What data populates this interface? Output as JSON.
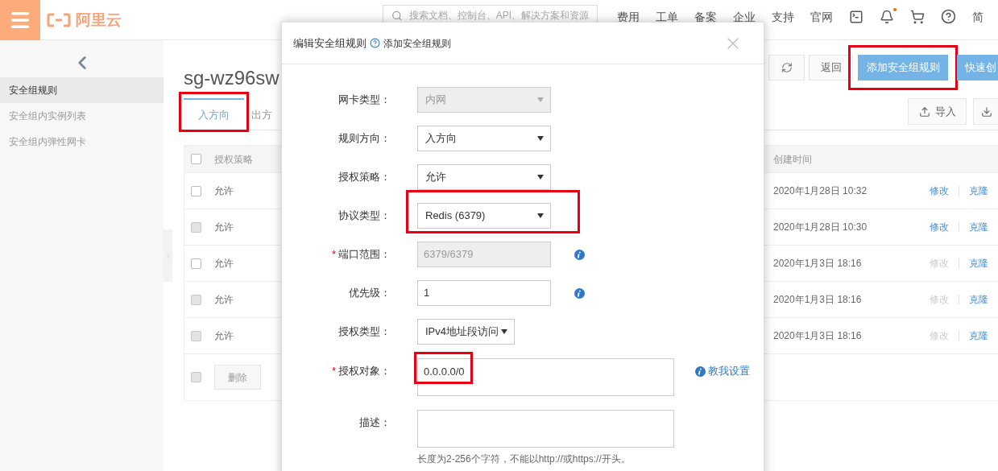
{
  "top_bar": {
    "logo": "阿里云",
    "search": {
      "placeholder": "搜索文档、控制台、API、解决方案和资源"
    },
    "nav": [
      "费用",
      "工单",
      "备案",
      "企业",
      "支持",
      "官网"
    ],
    "notification_dot": true,
    "language": "简"
  },
  "sidebar": {
    "items": [
      {
        "label": "安全组规则",
        "selected": true
      },
      {
        "label": "安全组内实例列表",
        "selected": false
      },
      {
        "label": "安全组内弹性网卡",
        "selected": false
      }
    ]
  },
  "page": {
    "title": "sg-wz96sw",
    "toolbar": [
      {
        "label": "返回",
        "kind": "default",
        "highlighted": false
      },
      {
        "label": "添加安全组规则",
        "kind": "primary",
        "highlighted": true
      },
      {
        "label": "快速创",
        "kind": "primary",
        "highlighted": false
      }
    ],
    "tabs": [
      {
        "label": "入方向",
        "selected": true,
        "highlighted": true
      },
      {
        "label": "出方",
        "selected": false,
        "highlighted": false
      }
    ],
    "import_button": "导入"
  },
  "table": {
    "columns": [
      "授权策略",
      "创建时间"
    ],
    "header_checked": false,
    "rows": [
      {
        "checked": false,
        "disabled": false,
        "policy": "允许",
        "created": "2020年1月28日 10:32",
        "actions": [
          {
            "label": "修改",
            "disabled": false
          },
          {
            "label": "克隆",
            "disabled": false
          }
        ]
      },
      {
        "checked": false,
        "disabled": true,
        "policy": "允许",
        "created": "2020年1月28日 10:30",
        "actions": [
          {
            "label": "修改",
            "disabled": false
          },
          {
            "label": "克隆",
            "disabled": false
          }
        ]
      },
      {
        "checked": false,
        "disabled": false,
        "policy": "允许",
        "created": "2020年1月3日 18:16",
        "actions": [
          {
            "label": "修改",
            "disabled": true
          },
          {
            "label": "克隆",
            "disabled": false
          }
        ]
      },
      {
        "checked": false,
        "disabled": true,
        "policy": "允许",
        "created": "2020年1月3日 18:16",
        "actions": [
          {
            "label": "修改",
            "disabled": true
          },
          {
            "label": "克隆",
            "disabled": false
          }
        ]
      },
      {
        "checked": false,
        "disabled": true,
        "policy": "允许",
        "created": "2020年1月3日 18:16",
        "actions": [
          {
            "label": "修改",
            "disabled": true
          },
          {
            "label": "克隆",
            "disabled": false
          }
        ]
      }
    ],
    "footer": {
      "checked": false,
      "delete_button": {
        "label": "删除",
        "disabled": true
      }
    }
  },
  "dialog": {
    "title": "编辑安全组规则",
    "help_link": "添加安全组规则",
    "fields": [
      {
        "label": "网卡类型：",
        "kind": "select",
        "value": "内网",
        "disabled": true,
        "info": false,
        "highlighted": false
      },
      {
        "label": "规则方向：",
        "kind": "select",
        "value": "入方向",
        "disabled": false,
        "info": false,
        "highlighted": false
      },
      {
        "label": "授权策略：",
        "kind": "select",
        "value": "允许",
        "disabled": false,
        "info": false,
        "highlighted": false
      },
      {
        "label": "协议类型：",
        "kind": "select",
        "value": "Redis (6379)",
        "disabled": false,
        "info": false,
        "highlighted": true
      },
      {
        "label": "端口范围：",
        "required_mark": "*",
        "kind": "input",
        "value": "6379/6379",
        "disabled": true,
        "info": true,
        "highlighted": false
      },
      {
        "label": "优先级：",
        "kind": "input",
        "value": "1",
        "disabled": false,
        "info": true,
        "highlighted": false
      },
      {
        "label": "授权类型：",
        "kind": "compact_select",
        "value": "IPv4地址段访问",
        "disabled": false,
        "info": false,
        "highlighted": false
      },
      {
        "label": "授权对象：",
        "required_mark": "*",
        "kind": "textarea",
        "value": "0.0.0.0/0",
        "disabled": false,
        "info": false,
        "highlighted": true,
        "help": "教我设置"
      },
      {
        "label": "描述：",
        "kind": "textarea",
        "disabled": false,
        "info": false,
        "highlighted": false,
        "hint": "长度为2-256个字符，不能以http://或https://开头。"
      }
    ]
  }
}
